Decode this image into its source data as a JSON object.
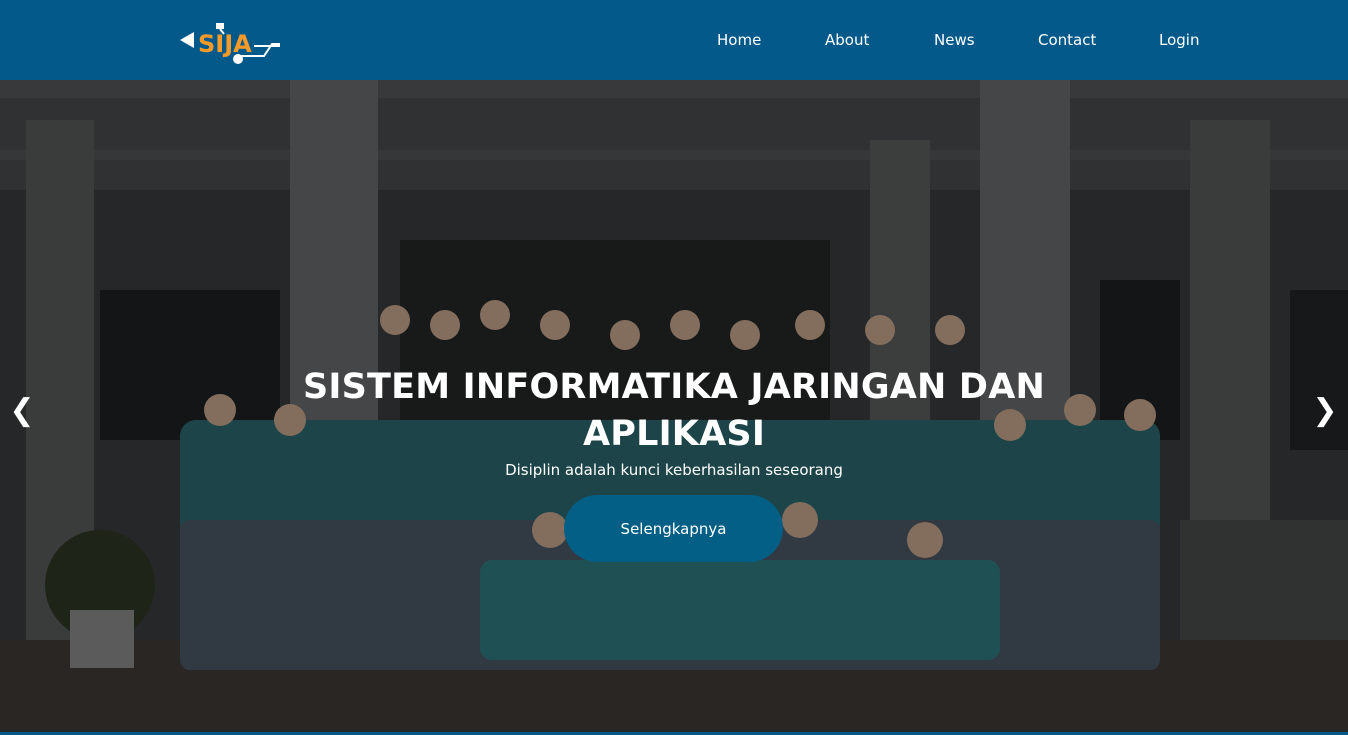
{
  "nav": {
    "logo_text": "SIJA",
    "links": [
      "Home",
      "About",
      "News",
      "Contact",
      "Login"
    ]
  },
  "hero": {
    "title_line1": "SISTEM INFORMATIKA JARINGAN DAN",
    "title_line2": "APLIKASI",
    "subtitle": "Disiplin adalah kunci keberhasilan seseorang",
    "button": "Selengkapnya",
    "prev_arrow": "❮",
    "next_arrow": "❯"
  },
  "colors": {
    "navbar": "#035a8a",
    "button": "#035f86",
    "logo_accent": "#f39a2a"
  }
}
